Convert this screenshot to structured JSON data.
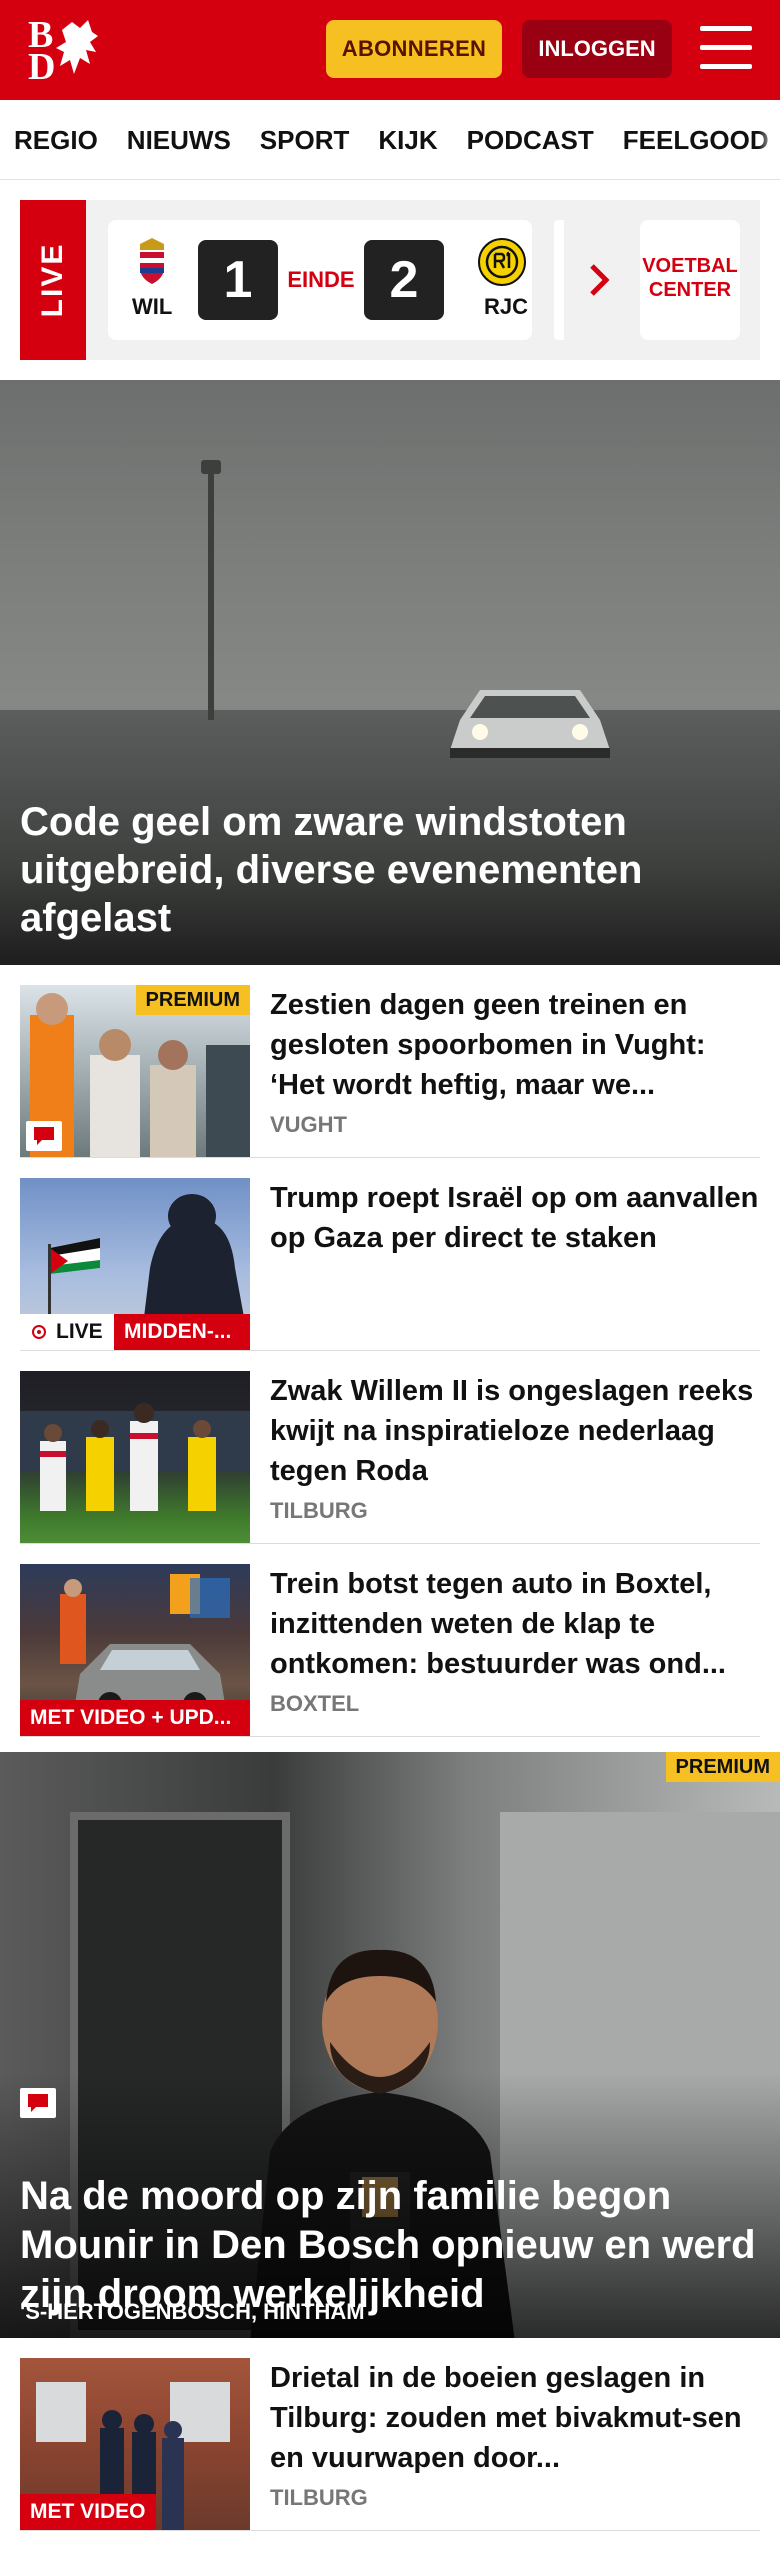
{
  "header": {
    "logo_text": "BD",
    "subscribe_label": "ABONNEREN",
    "login_label": "INLOGGEN",
    "menu_icon": "hamburger-menu-icon",
    "brand_color": "#d4000f",
    "accent_color": "#f6c022"
  },
  "nav": {
    "items": [
      "REGIO",
      "NIEUWS",
      "SPORT",
      "KIJK",
      "PODCAST",
      "FEELGOOD"
    ]
  },
  "live": {
    "label": "LIVE",
    "home_team": "WIL",
    "away_team": "RJC",
    "home_score": "1",
    "away_score": "2",
    "status": "EINDE",
    "football_center": "VOETBAL CENTER"
  },
  "hero": {
    "title": "Code geel om zware windstoten uitgebreid, diverse evenementen afgelast"
  },
  "articles": [
    {
      "title": "Zestien dagen geen treinen en gesloten spoorbomen in Vught: ‘Het wordt heftig, maar we...",
      "tag": "VUGHT",
      "badge": "PREMIUM"
    },
    {
      "title": "Trump roept Israël op om aanvallen op Gaza per direct te staken",
      "live_label": "LIVE",
      "label": "MIDDEN-..."
    },
    {
      "title": "Zwak Willem II is ongeslagen reeks kwijt na inspiratieloze nederlaag tegen Roda",
      "tag": "TILBURG"
    },
    {
      "title": "Trein botst tegen auto in Boxtel, inzittenden weten de klap te ontkomen: bestuurder was ond...",
      "tag": "BOXTEL",
      "label": "MET VIDEO + UPD..."
    }
  ],
  "feature": {
    "title": "Na de moord op zijn familie begon Mounir in Den Bosch opnieuw en werd zijn droom werkelijkheid",
    "tag": "'S-HERTOGENBOSCH, HINTHAM",
    "badge": "PREMIUM"
  },
  "articles2": [
    {
      "title": "Drietal in de boeien geslagen in Tilburg: zouden met bivakmut-sen en vuurwapen door...",
      "tag": "TILBURG",
      "label": "MET VIDEO"
    }
  ]
}
